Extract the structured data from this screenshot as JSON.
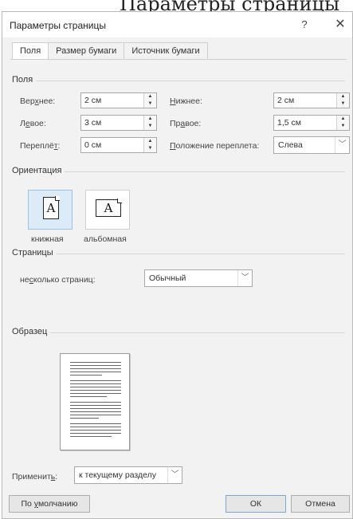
{
  "background_heading": "Параметры страницы",
  "dialog": {
    "title": "Параметры страницы",
    "help_label": "?",
    "close_label": "✕"
  },
  "tabs": [
    {
      "label": "Поля",
      "active": true
    },
    {
      "label": "Размер бумаги",
      "active": false
    },
    {
      "label": "Источник бумаги",
      "active": false
    }
  ],
  "margins": {
    "group_label": "Поля",
    "top": {
      "label_pre": "Вер",
      "label_u": "х",
      "label_post": "нее:",
      "value": "2 см"
    },
    "bottom": {
      "label_pre": "",
      "label_u": "Н",
      "label_post": "ижнее:",
      "value": "2 см"
    },
    "left": {
      "label_pre": "Л",
      "label_u": "е",
      "label_post": "вое:",
      "value": "3 см"
    },
    "right": {
      "label_pre": "Пр",
      "label_u": "а",
      "label_post": "вое:",
      "value": "1,5 см"
    },
    "gutter": {
      "label_pre": "Переплё",
      "label_u": "т",
      "label_post": ":",
      "value": "0 см"
    },
    "gutter_position": {
      "label_pre": "",
      "label_u": "П",
      "label_post": "оложение переплета:",
      "value": "Слева"
    }
  },
  "orientation": {
    "group_label": "Ориентация",
    "portrait_label": "книжная",
    "landscape_label": "альбомная",
    "icon_letter": "A",
    "selected": "portrait"
  },
  "pages": {
    "group_label": "Страницы",
    "multiple_label_pre": "не",
    "multiple_label_u": "с",
    "multiple_label_post": "колько страниц:",
    "multiple_value": "Обычный"
  },
  "preview": {
    "group_label": "Образец"
  },
  "apply": {
    "label_pre": "Применит",
    "label_u": "ь",
    "label_post": ":",
    "value": "к текущему разделу"
  },
  "buttons": {
    "default_pre": "По ",
    "default_u": "у",
    "default_post": "молчанию",
    "ok": "ОК",
    "cancel": "Отмена"
  }
}
